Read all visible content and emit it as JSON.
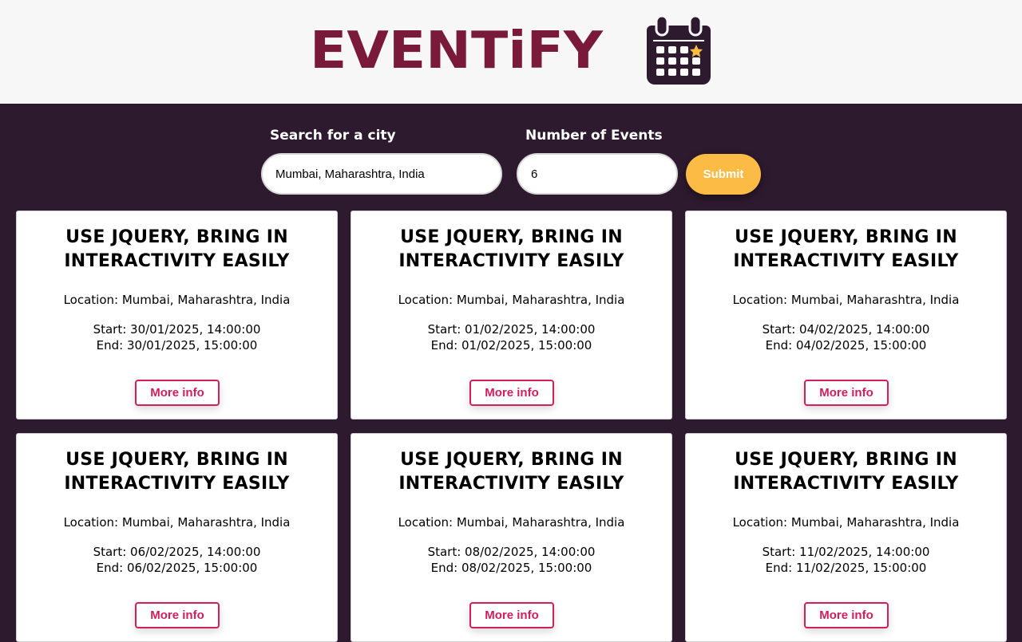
{
  "brand": {
    "name": "EVENTiFY",
    "color": "#7a1a3a"
  },
  "search": {
    "city_label": "Search for a city",
    "city_value": "Mumbai, Maharashtra, India",
    "number_label": "Number of Events",
    "number_value": "6",
    "submit_label": "Submit"
  },
  "colors": {
    "header_bg": "#f7f7f7",
    "main_bg": "#2d1a2e",
    "accent": "#fcbb45",
    "more_info": "#d21e5a"
  },
  "events": [
    {
      "title": "USE JQUERY, BRING IN INTERACTIVITY EASILY",
      "location": "Location: Mumbai, Maharashtra, India",
      "start": "Start: 30/01/2025, 14:00:00",
      "end": "End: 30/01/2025, 15:00:00",
      "button": "More info"
    },
    {
      "title": "USE JQUERY, BRING IN INTERACTIVITY EASILY",
      "location": "Location: Mumbai, Maharashtra, India",
      "start": "Start: 01/02/2025, 14:00:00",
      "end": "End: 01/02/2025, 15:00:00",
      "button": "More info"
    },
    {
      "title": "USE JQUERY, BRING IN INTERACTIVITY EASILY",
      "location": "Location: Mumbai, Maharashtra, India",
      "start": "Start: 04/02/2025, 14:00:00",
      "end": "End: 04/02/2025, 15:00:00",
      "button": "More info"
    },
    {
      "title": "USE JQUERY, BRING IN INTERACTIVITY EASILY",
      "location": "Location: Mumbai, Maharashtra, India",
      "start": "Start: 06/02/2025, 14:00:00",
      "end": "End: 06/02/2025, 15:00:00",
      "button": "More info"
    },
    {
      "title": "USE JQUERY, BRING IN INTERACTIVITY EASILY",
      "location": "Location: Mumbai, Maharashtra, India",
      "start": "Start: 08/02/2025, 14:00:00",
      "end": "End: 08/02/2025, 15:00:00",
      "button": "More info"
    },
    {
      "title": "USE JQUERY, BRING IN INTERACTIVITY EASILY",
      "location": "Location: Mumbai, Maharashtra, India",
      "start": "Start: 11/02/2025, 14:00:00",
      "end": "End: 11/02/2025, 15:00:00",
      "button": "More info"
    }
  ]
}
